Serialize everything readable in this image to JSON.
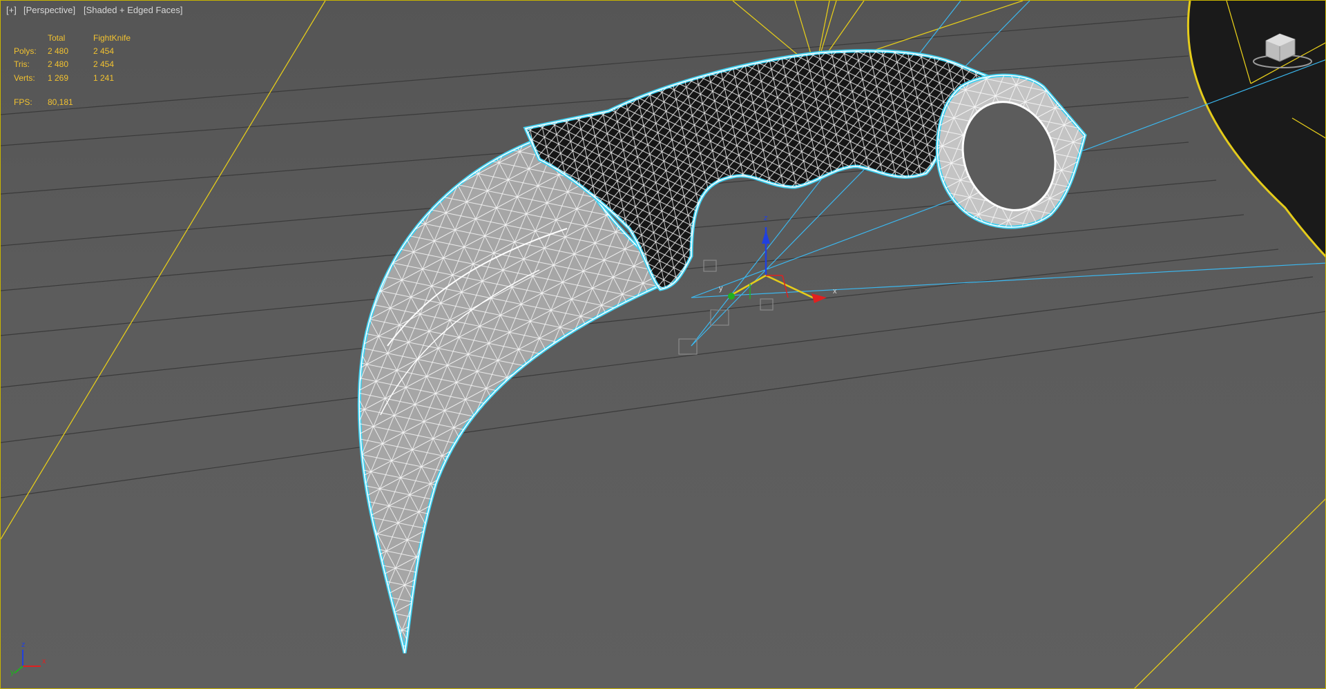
{
  "viewport": {
    "menu": {
      "plus": "[+]",
      "view": "[Perspective]",
      "shading": "[Shaded + Edged Faces]"
    },
    "stats": {
      "headers": [
        "",
        "Total",
        "FightKnife"
      ],
      "rows": [
        {
          "label": "Polys:",
          "total": "2 480",
          "object": "2 454"
        },
        {
          "label": "Tris:",
          "total": "2 480",
          "object": "2 454"
        },
        {
          "label": "Verts:",
          "total": "1 269",
          "object": "1 241"
        }
      ],
      "fps_label": "FPS:",
      "fps_value": "80,181"
    },
    "gizmo": {
      "x": "x",
      "y": "y",
      "z": "z"
    },
    "axis_tripod": {
      "x": "x",
      "y": "y",
      "z": "z"
    }
  },
  "colors": {
    "background": "#5e5e5e",
    "grid_line": "#3a3a3a",
    "camera_frustum": "#e5cc1a",
    "selection_highlight": "#3fd0f0",
    "wire": "#ffffff",
    "handle": "#151515",
    "blade": "#a8a8a8",
    "stats_text": "#f2c230",
    "axis_x": "#e02020",
    "axis_y": "#20b020",
    "axis_z": "#2040e0"
  },
  "icons": [
    "viewcube-icon",
    "transform-gizmo-icon",
    "axis-tripod-icon"
  ]
}
